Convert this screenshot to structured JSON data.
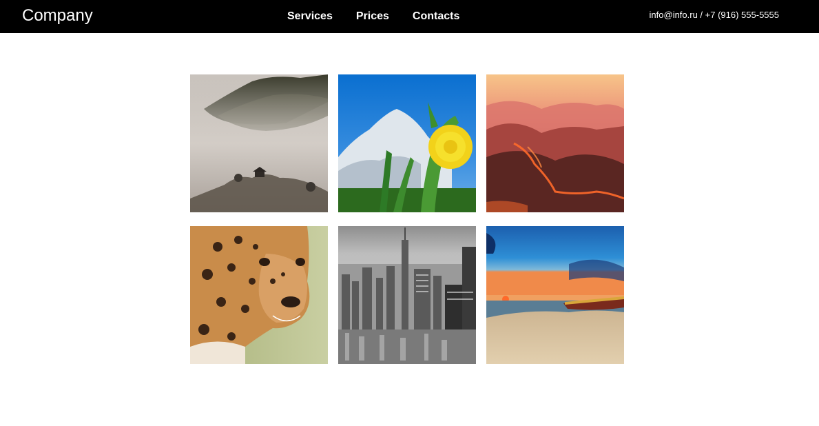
{
  "header": {
    "brand": "Company",
    "nav": [
      {
        "label": "Services"
      },
      {
        "label": "Prices"
      },
      {
        "label": "Contacts"
      }
    ],
    "contact": "info@info.ru / +7 (916) 555-5555"
  },
  "gallery": {
    "items": [
      {
        "subject": "foggy-mountain-pagoda"
      },
      {
        "subject": "dandelion-mountain"
      },
      {
        "subject": "volcanic-mountains"
      },
      {
        "subject": "leopard"
      },
      {
        "subject": "city-skyline-bw"
      },
      {
        "subject": "beach-sunset-boat"
      }
    ]
  },
  "colors": {
    "header_bg": "#000000",
    "header_text": "#ffffff",
    "page_bg": "#ffffff"
  }
}
